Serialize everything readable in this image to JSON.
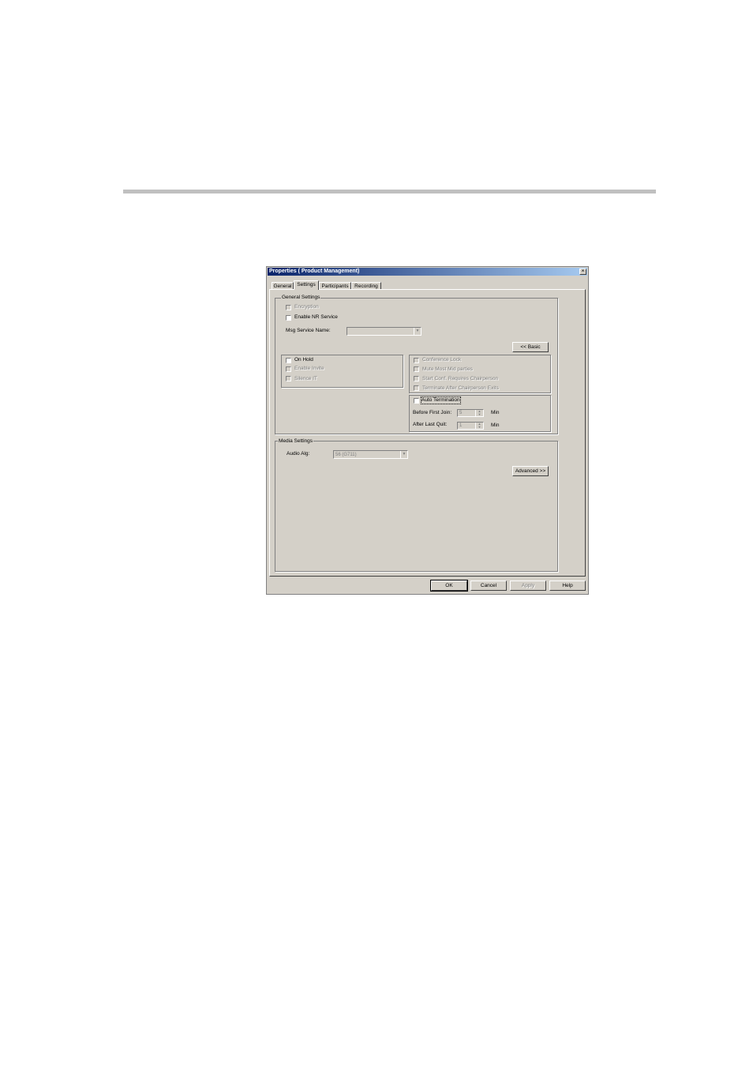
{
  "window": {
    "title": "Properties  ( Product Management)",
    "close_label": "×"
  },
  "tabs": [
    "General",
    "Settings",
    "Participants",
    "Recording"
  ],
  "general_settings": {
    "label": "General Settings",
    "encryption": "Encryption",
    "enable_nr_service": "Enable NR Service",
    "msg_service_name": "Msg Service Name:",
    "basic_button": "<< Basic",
    "left_options": [
      "On Hold",
      "Enable Invite",
      "Silence IT"
    ],
    "right_options": [
      "Conference Lock",
      "Mute Most Mid parties",
      "Start Conf. Requires Chairperson",
      "Terminate After Chairperson Exits"
    ],
    "auto_termination": "Auto Termination",
    "before_first_join": {
      "label": "Before First Join:",
      "value": "5",
      "unit": "Min"
    },
    "after_last_quit": {
      "label": "After Last Quit:",
      "value": "1",
      "unit": "Min"
    }
  },
  "media_settings": {
    "label": "Media Settings",
    "audio_alg_label": "Audio Alg:",
    "audio_alg_value": "56 (G711)",
    "advanced_button": "Advanced >>"
  },
  "footer": {
    "ok": "OK",
    "cancel": "Cancel",
    "apply": "Apply",
    "help": "Help"
  }
}
